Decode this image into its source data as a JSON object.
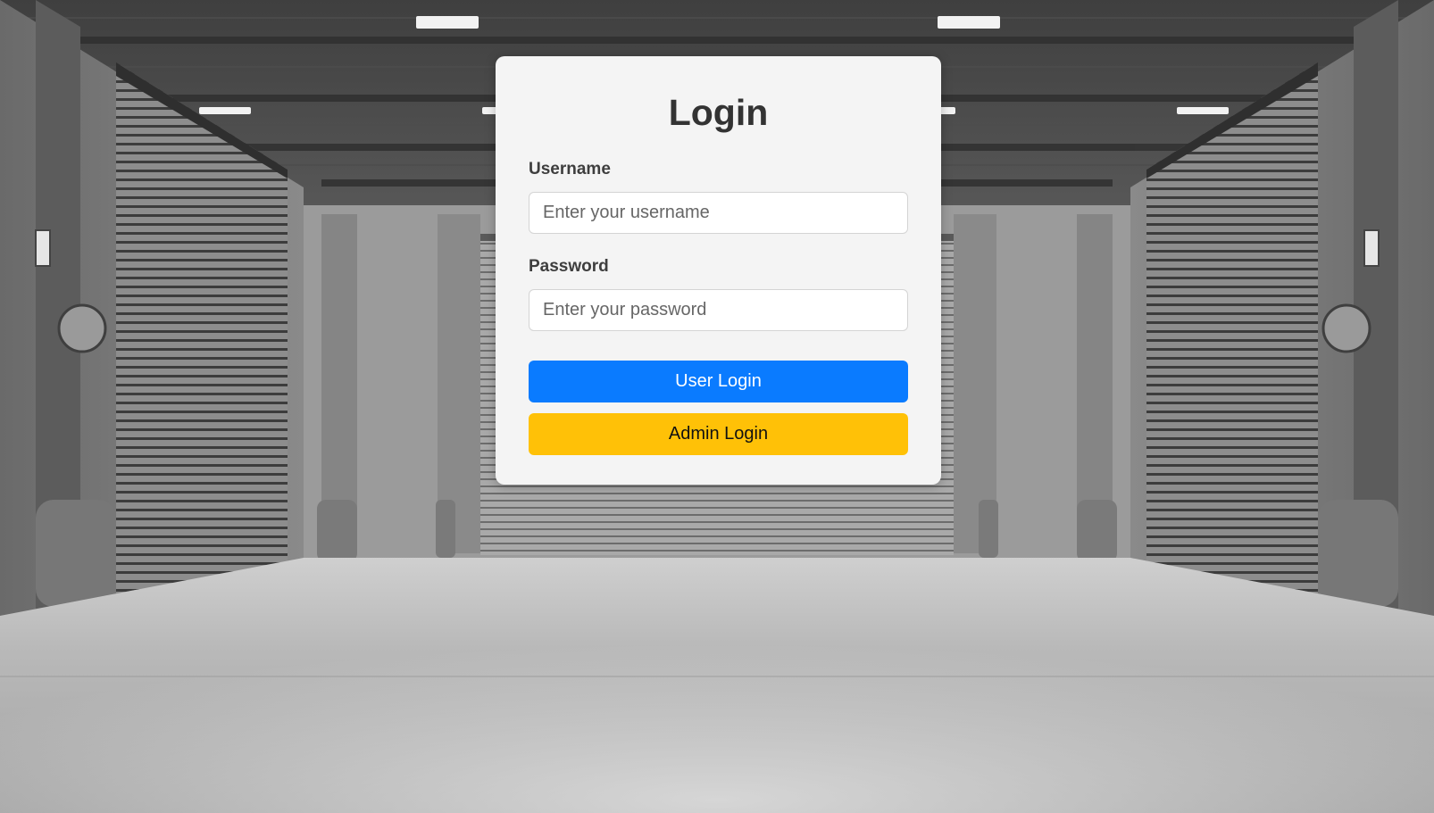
{
  "login": {
    "title": "Login",
    "username_label": "Username",
    "username_placeholder": "Enter your username",
    "username_value": "",
    "password_label": "Password",
    "password_placeholder": "Enter your password",
    "password_value": "",
    "user_login_label": "User Login",
    "admin_login_label": "Admin Login"
  },
  "colors": {
    "card_background": "#f4f4f4",
    "user_login_button": "#0a7bff",
    "admin_login_button": "#ffc107",
    "title_text": "#333333"
  },
  "background": {
    "icon": "garage-interior-image"
  }
}
